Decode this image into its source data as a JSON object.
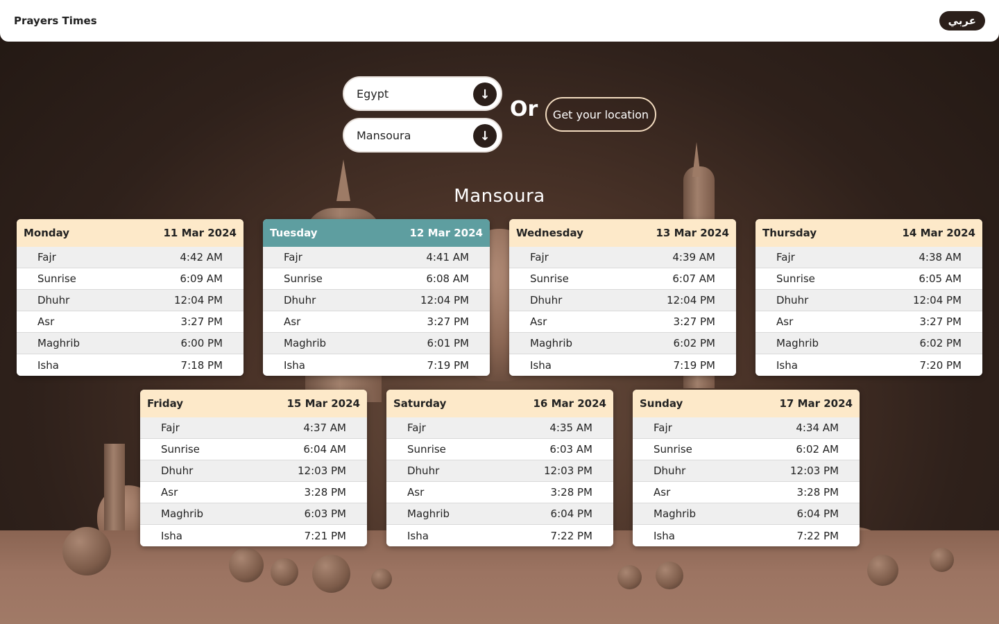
{
  "header": {
    "brand": "Prayers Times",
    "lang_button": "عربي"
  },
  "selectors": {
    "country": "Egypt",
    "city": "Mansoura",
    "or_text": "Or",
    "location_button": "Get your location"
  },
  "city_title": "Mansoura",
  "prayer_names": [
    "Fajr",
    "Sunrise",
    "Dhuhr",
    "Asr",
    "Maghrib",
    "Isha"
  ],
  "days": [
    {
      "day": "Monday",
      "date": "11 Mar 2024",
      "active": false,
      "times": [
        "4:42 AM",
        "6:09 AM",
        "12:04 PM",
        "3:27 PM",
        "6:00 PM",
        "7:18 PM"
      ]
    },
    {
      "day": "Tuesday",
      "date": "12 Mar 2024",
      "active": true,
      "times": [
        "4:41 AM",
        "6:08 AM",
        "12:04 PM",
        "3:27 PM",
        "6:01 PM",
        "7:19 PM"
      ]
    },
    {
      "day": "Wednesday",
      "date": "13 Mar 2024",
      "active": false,
      "times": [
        "4:39 AM",
        "6:07 AM",
        "12:04 PM",
        "3:27 PM",
        "6:02 PM",
        "7:19 PM"
      ]
    },
    {
      "day": "Thursday",
      "date": "14 Mar 2024",
      "active": false,
      "times": [
        "4:38 AM",
        "6:05 AM",
        "12:04 PM",
        "3:27 PM",
        "6:02 PM",
        "7:20 PM"
      ]
    },
    {
      "day": "Friday",
      "date": "15 Mar 2024",
      "active": false,
      "times": [
        "4:37 AM",
        "6:04 AM",
        "12:03 PM",
        "3:28 PM",
        "6:03 PM",
        "7:21 PM"
      ]
    },
    {
      "day": "Saturday",
      "date": "16 Mar 2024",
      "active": false,
      "times": [
        "4:35 AM",
        "6:03 AM",
        "12:03 PM",
        "3:28 PM",
        "6:04 PM",
        "7:22 PM"
      ]
    },
    {
      "day": "Sunday",
      "date": "17 Mar 2024",
      "active": false,
      "times": [
        "4:34 AM",
        "6:02 AM",
        "12:03 PM",
        "3:28 PM",
        "6:04 PM",
        "7:22 PM"
      ]
    }
  ],
  "icons": {
    "dropdown": "arrow-down-icon"
  },
  "colors": {
    "header_bg": "#fde9c9",
    "active_header_bg": "#5e9ea0",
    "dark": "#2b1f1a"
  }
}
